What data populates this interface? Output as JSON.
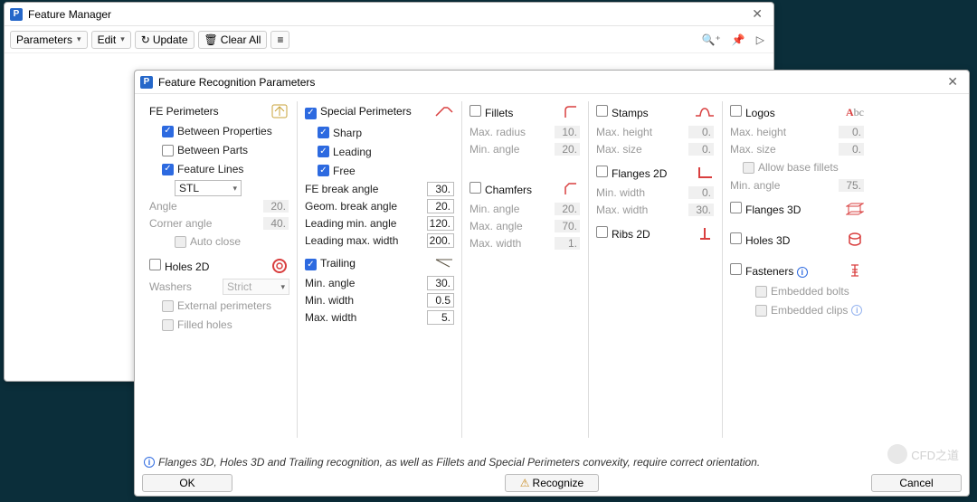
{
  "window1": {
    "title": "Feature Manager",
    "toolbar": {
      "parameters": "Parameters",
      "edit": "Edit",
      "update": "Update",
      "clearAll": "Clear All"
    }
  },
  "window2": {
    "title": "Feature Recognition Parameters",
    "buttons": {
      "ok": "OK",
      "recognize": "Recognize",
      "cancel": "Cancel"
    },
    "info": "Flanges 3D, Holes 3D and Trailing recognition, as well as Fillets and Special Perimeters convexity, require correct orientation."
  },
  "fePerimeters": {
    "title": "FE Perimeters",
    "betweenProperties": "Between Properties",
    "betweenParts": "Between Parts",
    "featureLines": "Feature Lines",
    "select": "STL",
    "angle": "Angle",
    "angleVal": "20.",
    "cornerAngle": "Corner angle",
    "cornerAngleVal": "40.",
    "autoClose": "Auto close"
  },
  "holes2d": {
    "title": "Holes 2D",
    "washers": "Washers",
    "washersVal": "Strict",
    "externalPerimeters": "External perimeters",
    "filledHoles": "Filled holes"
  },
  "specialPerimeters": {
    "title": "Special Perimeters",
    "sharp": "Sharp",
    "leading": "Leading",
    "free": "Free",
    "feBreakAngle": "FE break angle",
    "feBreakAngleVal": "30.",
    "geomBreakAngle": "Geom. break angle",
    "geomBreakAngleVal": "20.",
    "leadingMinAngle": "Leading min. angle",
    "leadingMinAngleVal": "120.",
    "leadingMaxWidth": "Leading max. width",
    "leadingMaxWidthVal": "200."
  },
  "trailing": {
    "title": "Trailing",
    "minAngle": "Min. angle",
    "minAngleVal": "30.",
    "minWidth": "Min. width",
    "minWidthVal": "0.5",
    "maxWidth": "Max. width",
    "maxWidthVal": "5."
  },
  "fillets": {
    "title": "Fillets",
    "maxRadius": "Max. radius",
    "maxRadiusVal": "10.",
    "minAngle": "Min. angle",
    "minAngleVal": "20."
  },
  "chamfers": {
    "title": "Chamfers",
    "minAngle": "Min. angle",
    "minAngleVal": "20.",
    "maxAngle": "Max. angle",
    "maxAngleVal": "70.",
    "maxWidth": "Max. width",
    "maxWidthVal": "1."
  },
  "stamps": {
    "title": "Stamps",
    "maxHeight": "Max. height",
    "maxHeightVal": "0.",
    "maxSize": "Max. size",
    "maxSizeVal": "0."
  },
  "flanges2d": {
    "title": "Flanges 2D",
    "minWidth": "Min. width",
    "minWidthVal": "0.",
    "maxWidth": "Max. width",
    "maxWidthVal": "30."
  },
  "ribs2d": {
    "title": "Ribs 2D"
  },
  "logos": {
    "title": "Logos",
    "maxHeight": "Max. height",
    "maxHeightVal": "0.",
    "maxSize": "Max. size",
    "maxSizeVal": "0.",
    "allowBaseFillets": "Allow base fillets",
    "minAngle": "Min. angle",
    "minAngleVal": "75."
  },
  "flanges3d": {
    "title": "Flanges 3D"
  },
  "holes3d": {
    "title": "Holes 3D"
  },
  "fasteners": {
    "title": "Fasteners",
    "embeddedBolts": "Embedded bolts",
    "embeddedClips": "Embedded clips"
  },
  "watermark": "CFD之道"
}
